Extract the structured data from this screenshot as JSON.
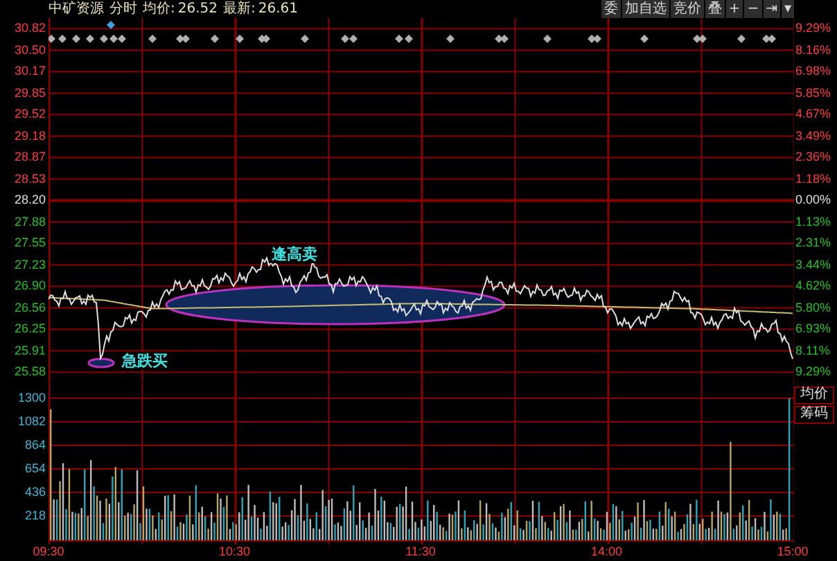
{
  "header": {
    "stock": "中矿资源",
    "mode": "分时",
    "avg_label": "均价:",
    "avg_value": "26.52",
    "last_label": "最新:",
    "last_value": "26.61"
  },
  "toolbar": [
    "委",
    "加自选",
    "竞价",
    "叠",
    "+",
    "−",
    "⇥",
    "▾"
  ],
  "price_axis": [
    {
      "price": "30.82",
      "percent": "9.29%",
      "color": "#ff3b3b"
    },
    {
      "price": "30.50",
      "percent": "8.16%",
      "color": "#ff3b3b"
    },
    {
      "price": "30.17",
      "percent": "6.98%",
      "color": "#ff3b3b"
    },
    {
      "price": "29.85",
      "percent": "5.85%",
      "color": "#ff3b3b"
    },
    {
      "price": "29.52",
      "percent": "4.67%",
      "color": "#ff3b3b"
    },
    {
      "price": "29.18",
      "percent": "3.49%",
      "color": "#ff3b3b"
    },
    {
      "price": "28.87",
      "percent": "2.36%",
      "color": "#ff3b3b"
    },
    {
      "price": "28.53",
      "percent": "1.18%",
      "color": "#ff3b3b"
    },
    {
      "price": "28.20",
      "percent": "0.00%",
      "color": "#e0e0e0"
    },
    {
      "price": "27.88",
      "percent": "1.13%",
      "color": "#22c322"
    },
    {
      "price": "27.55",
      "percent": "2.31%",
      "color": "#22c322"
    },
    {
      "price": "27.23",
      "percent": "3.44%",
      "color": "#22c322"
    },
    {
      "price": "26.90",
      "percent": "4.62%",
      "color": "#22c322"
    },
    {
      "price": "26.56",
      "percent": "5.80%",
      "color": "#22c322"
    },
    {
      "price": "26.25",
      "percent": "6.93%",
      "color": "#22c322"
    },
    {
      "price": "25.91",
      "percent": "8.11%",
      "color": "#22c322"
    },
    {
      "price": "25.58",
      "percent": "9.29%",
      "color": "#22c322"
    }
  ],
  "volume_axis": [
    "1300",
    "1082",
    "864",
    "654",
    "436",
    "218"
  ],
  "side_buttons": [
    "均价",
    "筹码"
  ],
  "annotations": [
    {
      "text": "逢高卖"
    },
    {
      "text": "急跌买"
    }
  ],
  "time_axis": [
    "09:30",
    "10:30",
    "11:30",
    "14:00",
    "15:00"
  ]
}
